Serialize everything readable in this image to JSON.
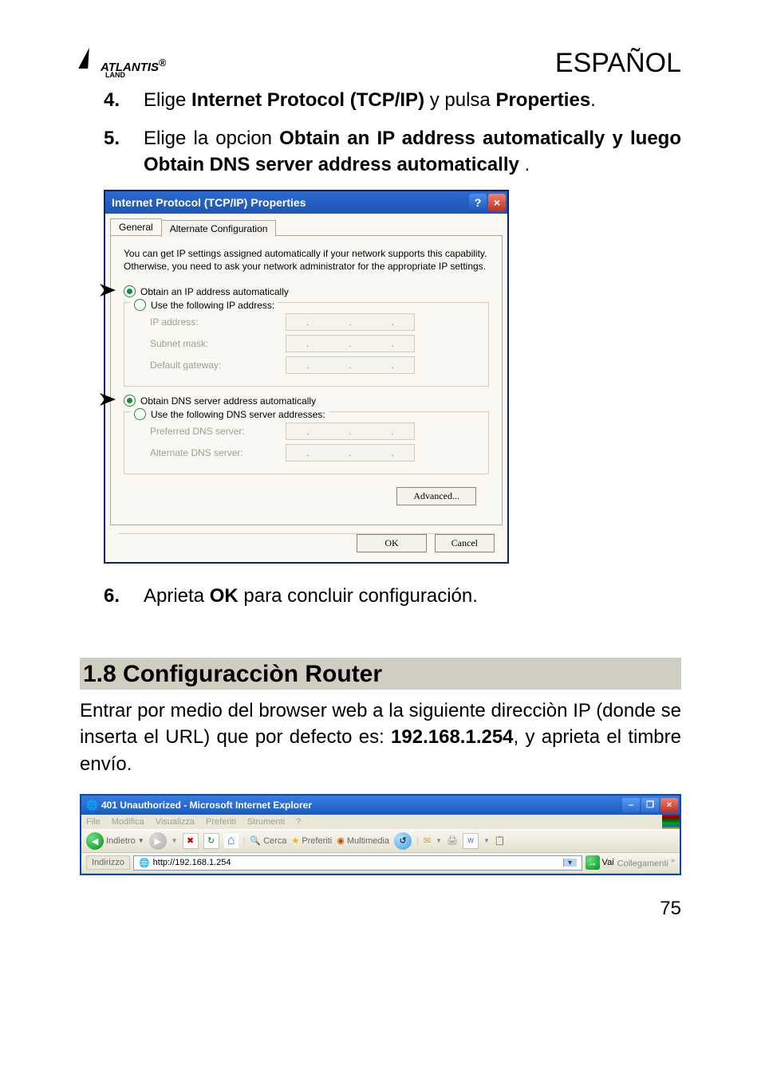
{
  "header": {
    "brand": "ATLANTIS",
    "brand_sub": "LAND",
    "language": "ESPAÑOL"
  },
  "steps": {
    "four": {
      "num": "4.",
      "pre": "Elige ",
      "bold1": "Internet Protocol (TCP/IP)",
      "mid": " y pulsa  ",
      "bold2": "Properties",
      "post": "."
    },
    "five": {
      "num": "5.",
      "pre": "Elige la opcion ",
      "bold": "Obtain an IP address automatically y luego Obtain DNS server address automatically ",
      "post": "."
    },
    "six": {
      "num": "6.",
      "pre": "Aprieta  ",
      "bold": "OK",
      "post": " para concluir configuración."
    }
  },
  "dialog": {
    "title": "Internet Protocol (TCP/IP) Properties",
    "tabs": {
      "general": "General",
      "alt": "Alternate Configuration"
    },
    "intro": "You can get IP settings assigned automatically if your network supports this capability. Otherwise, you need to ask your network administrator for the appropriate IP settings.",
    "radio_obtain_ip": "Obtain an IP address automatically",
    "radio_use_ip": "Use the following IP address:",
    "lbl_ip": "IP address:",
    "lbl_mask": "Subnet mask:",
    "lbl_gw": "Default gateway:",
    "radio_obtain_dns": "Obtain DNS server address automatically",
    "radio_use_dns": "Use the following DNS server addresses:",
    "lbl_pdns": "Preferred DNS server:",
    "lbl_adns": "Alternate DNS server:",
    "advanced": "Advanced...",
    "ok": "OK",
    "cancel": "Cancel"
  },
  "section": {
    "heading": "1.8 Configuracciòn Router",
    "para_pre": "Entrar por medio del browser web a la siguiente direcciòn IP (donde se inserta el URL) que por defecto es: ",
    "para_bold": "192.168.1.254",
    "para_post": ", y aprieta el timbre  envío."
  },
  "ie": {
    "title": "401 Unauthorized - Microsoft Internet Explorer",
    "menu": [
      "File",
      "Modifica",
      "Visualizza",
      "Preferiti",
      "Strumenti",
      "?"
    ],
    "back": "Indietro",
    "search": "Cerca",
    "favorites": "Preferiti",
    "media": "Multimedia",
    "addr_label": "Indirizzo",
    "url": "http://192.168.1.254",
    "go": "Vai",
    "links": "Collegamenti"
  },
  "page_number": "75"
}
